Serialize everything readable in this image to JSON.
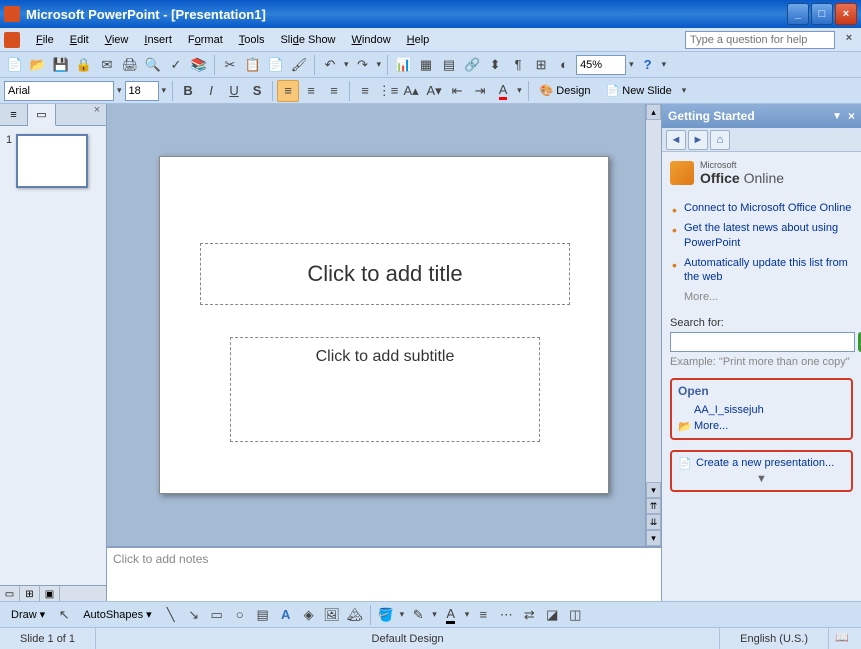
{
  "title": "Microsoft PowerPoint - [Presentation1]",
  "menu": {
    "file": "File",
    "edit": "Edit",
    "view": "View",
    "insert": "Insert",
    "format": "Format",
    "tools": "Tools",
    "slideshow": "Slide Show",
    "window": "Window",
    "help": "Help"
  },
  "help_placeholder": "Type a question for help",
  "toolbar": {
    "zoom": "45%",
    "font": "Arial",
    "size": "18",
    "design_label": "Design",
    "newslide_label": "New Slide"
  },
  "slide": {
    "title_placeholder": "Click to add title",
    "subtitle_placeholder": "Click to add subtitle",
    "notes_placeholder": "Click to add notes",
    "thumb_number": "1"
  },
  "taskpane": {
    "title": "Getting Started",
    "office_brand_prefix": "Microsoft",
    "office_brand_bold": "Office",
    "office_brand_suffix": "Online",
    "links": [
      "Connect to Microsoft Office Online",
      "Get the latest news about using PowerPoint",
      "Automatically update this list from the web"
    ],
    "more": "More...",
    "search_label": "Search for:",
    "example_label": "Example:",
    "example_text": "\"Print more than one copy\"",
    "open_title": "Open",
    "open_recent": "AA_I_sissejuh",
    "open_more": "More...",
    "create_new": "Create a new presentation..."
  },
  "drawbar": {
    "draw_label": "Draw",
    "autoshapes_label": "AutoShapes"
  },
  "status": {
    "slide_info": "Slide 1 of 1",
    "design": "Default Design",
    "language": "English (U.S.)"
  }
}
